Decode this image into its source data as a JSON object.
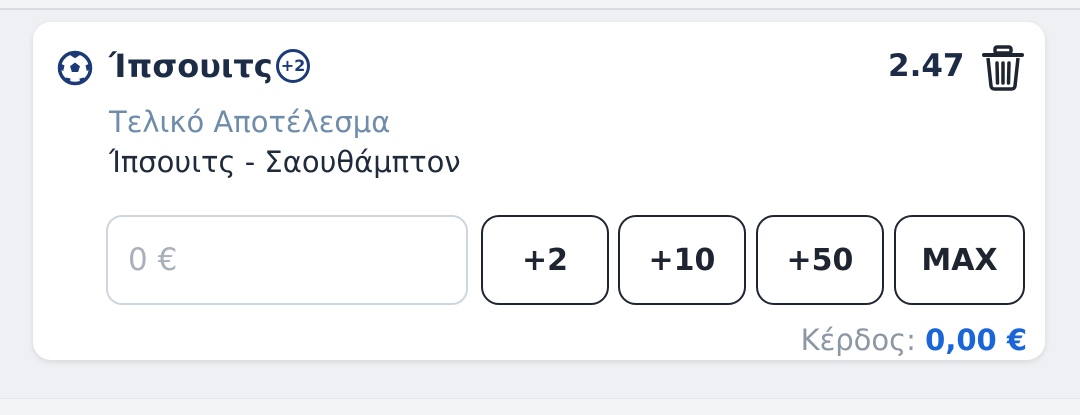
{
  "selection": {
    "team": "Ίπσουιτς",
    "extra_badge": "+2",
    "odds": "2.47",
    "market": "Τελικό Αποτέλεσμα",
    "event": "Ίπσουιτς - Σαουθάμπτον"
  },
  "stake": {
    "placeholder": "0 €",
    "value": ""
  },
  "quick_buttons": {
    "b1": "+2",
    "b2": "+10",
    "b3": "+50",
    "b4": "MAX"
  },
  "profit": {
    "label": "Κέρδος:",
    "value": "0,00 €"
  },
  "icons": {
    "sport": "soccer-ball-icon",
    "delete": "trash-icon"
  },
  "colors": {
    "title": "#1c2b46",
    "market": "#6f8cab",
    "badge": "#1d3a78",
    "profit_value": "#1a66d9",
    "button_border": "#1f2530"
  }
}
